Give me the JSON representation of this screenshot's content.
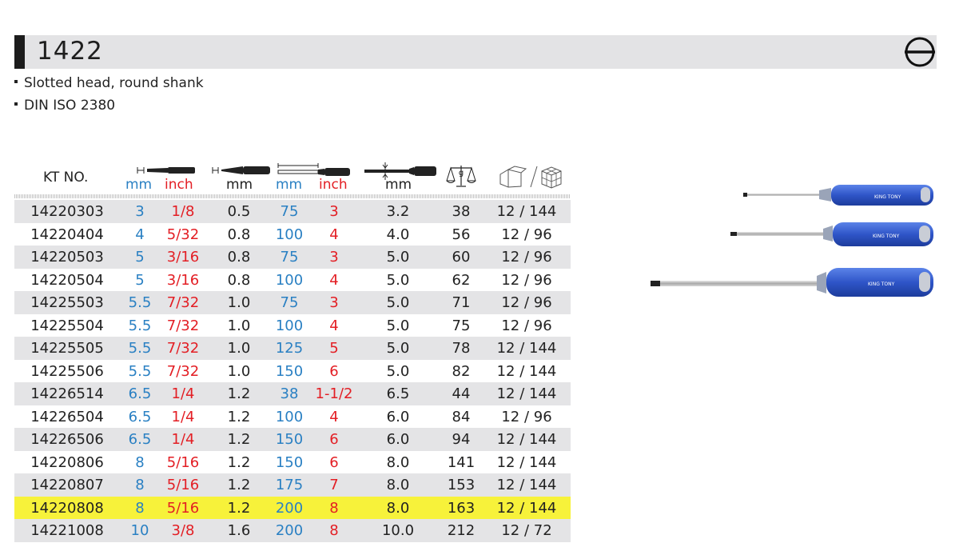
{
  "title": "1422",
  "bullets": [
    "Slotted head, round shank",
    "DIN ISO 2380"
  ],
  "header": {
    "kt_no": "KT NO.",
    "mm": "mm",
    "inch": "inch"
  },
  "handle_brand": "KING TONY",
  "highlight_row": "14220808",
  "colors": {
    "mm": "#2a80c3",
    "inch": "#e31e24",
    "row_shade": "#e4e4e6",
    "highlight": "#f7f23a",
    "handle_blue": "#2f55c8"
  },
  "rows": [
    {
      "kt": "14220303",
      "tip_mm": "3",
      "tip_inch": "1/8",
      "thickness_mm": "0.5",
      "length_mm": "75",
      "length_inch": "3",
      "shank_mm": "3.2",
      "weight_g": "38",
      "pack": "12 / 144"
    },
    {
      "kt": "14220404",
      "tip_mm": "4",
      "tip_inch": "5/32",
      "thickness_mm": "0.8",
      "length_mm": "100",
      "length_inch": "4",
      "shank_mm": "4.0",
      "weight_g": "56",
      "pack": "12 / 96"
    },
    {
      "kt": "14220503",
      "tip_mm": "5",
      "tip_inch": "3/16",
      "thickness_mm": "0.8",
      "length_mm": "75",
      "length_inch": "3",
      "shank_mm": "5.0",
      "weight_g": "60",
      "pack": "12 / 96"
    },
    {
      "kt": "14220504",
      "tip_mm": "5",
      "tip_inch": "3/16",
      "thickness_mm": "0.8",
      "length_mm": "100",
      "length_inch": "4",
      "shank_mm": "5.0",
      "weight_g": "62",
      "pack": "12 / 96"
    },
    {
      "kt": "14225503",
      "tip_mm": "5.5",
      "tip_inch": "7/32",
      "thickness_mm": "1.0",
      "length_mm": "75",
      "length_inch": "3",
      "shank_mm": "5.0",
      "weight_g": "71",
      "pack": "12 / 96"
    },
    {
      "kt": "14225504",
      "tip_mm": "5.5",
      "tip_inch": "7/32",
      "thickness_mm": "1.0",
      "length_mm": "100",
      "length_inch": "4",
      "shank_mm": "5.0",
      "weight_g": "75",
      "pack": "12 / 96"
    },
    {
      "kt": "14225505",
      "tip_mm": "5.5",
      "tip_inch": "7/32",
      "thickness_mm": "1.0",
      "length_mm": "125",
      "length_inch": "5",
      "shank_mm": "5.0",
      "weight_g": "78",
      "pack": "12 / 144"
    },
    {
      "kt": "14225506",
      "tip_mm": "5.5",
      "tip_inch": "7/32",
      "thickness_mm": "1.0",
      "length_mm": "150",
      "length_inch": "6",
      "shank_mm": "5.0",
      "weight_g": "82",
      "pack": "12 / 144"
    },
    {
      "kt": "14226514",
      "tip_mm": "6.5",
      "tip_inch": "1/4",
      "thickness_mm": "1.2",
      "length_mm": "38",
      "length_inch": "1-1/2",
      "shank_mm": "6.5",
      "weight_g": "44",
      "pack": "12 / 144"
    },
    {
      "kt": "14226504",
      "tip_mm": "6.5",
      "tip_inch": "1/4",
      "thickness_mm": "1.2",
      "length_mm": "100",
      "length_inch": "4",
      "shank_mm": "6.0",
      "weight_g": "84",
      "pack": "12 / 96"
    },
    {
      "kt": "14226506",
      "tip_mm": "6.5",
      "tip_inch": "1/4",
      "thickness_mm": "1.2",
      "length_mm": "150",
      "length_inch": "6",
      "shank_mm": "6.0",
      "weight_g": "94",
      "pack": "12 / 144"
    },
    {
      "kt": "14220806",
      "tip_mm": "8",
      "tip_inch": "5/16",
      "thickness_mm": "1.2",
      "length_mm": "150",
      "length_inch": "6",
      "shank_mm": "8.0",
      "weight_g": "141",
      "pack": "12 / 144"
    },
    {
      "kt": "14220807",
      "tip_mm": "8",
      "tip_inch": "5/16",
      "thickness_mm": "1.2",
      "length_mm": "175",
      "length_inch": "7",
      "shank_mm": "8.0",
      "weight_g": "153",
      "pack": "12 / 144"
    },
    {
      "kt": "14220808",
      "tip_mm": "8",
      "tip_inch": "5/16",
      "thickness_mm": "1.2",
      "length_mm": "200",
      "length_inch": "8",
      "shank_mm": "8.0",
      "weight_g": "163",
      "pack": "12 / 144"
    },
    {
      "kt": "14221008",
      "tip_mm": "10",
      "tip_inch": "3/8",
      "thickness_mm": "1.6",
      "length_mm": "200",
      "length_inch": "8",
      "shank_mm": "10.0",
      "weight_g": "212",
      "pack": "12 / 72"
    }
  ]
}
